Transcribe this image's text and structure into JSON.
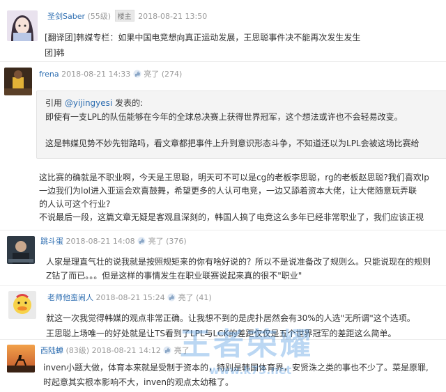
{
  "posts": [
    {
      "user": "圣剑Saber",
      "level": "(55级)",
      "badge": "楼主",
      "time": "2018-08-21 13:50",
      "lines": [
        "[翻译团]韩媒专栏：如果中国电竞想向真正运动发展，王思聪事件决不能再次发生发生",
        "团]韩"
      ]
    },
    {
      "user": "frena",
      "time": "2018-08-21 14:33",
      "like": "亮了",
      "like_count": "(274)",
      "quote": {
        "head_prefix": "引用",
        "head_user": "@yijingyesi",
        "head_suffix": "发表的:",
        "line1": "即使有一支LPL的队伍能够在今年的全球总决赛上获得世界冠军，这个想法或许也不会轻易改变。",
        "line2": "这是韩媒见势不妙先钳路吗，看文章都把事件上升到意识形态斗争，不知道还以为LPL会被这场比赛给"
      },
      "lines": [
        "这比赛的确就是不职业啊，今天是王思聪，明天可不可以是cg的老板李思聪，rg的老板赵思聪?我们喜欢lp",
        "一边我们为lol进入亚运会欢喜鼓舞，希望更多的人认可电竞，一边又舔着资本大佬，让大佬随意玩弄联",
        "的人认可这个行业?",
        "不说最后一段，这篇文章无疑是客观且深刻的，韩国人搞了电竞这么多年已经非常职业了，我们应该正视"
      ]
    },
    {
      "user": "跳斗蛋",
      "time": "2018-08-21 14:08",
      "like": "亮了",
      "like_count": "(376)",
      "lines": [
        "人家是理直气壮的说我就是按照规矩来的你有啥好说的？所以不是说准备改了规则么。只能说现在的规则",
        "Z钻了而已。。。但是这样的事情发生在职业联赛说起来真的很不\"职业\""
      ]
    },
    {
      "user": "老师他蛮闹人",
      "time": "2018-08-21 15:24",
      "like": "亮了",
      "like_count": "(41)",
      "lines": [
        "就这一次我觉得韩媒的观点非常正确。让我想不到的是虎扑居然会有30%的人选\"无所谓\"这个选项。",
        "王思聪上场唯一的好处就是让TS看到了LPL与LCK的差距仅仅是五个世界冠军的差距这么简单。"
      ]
    },
    {
      "user": "西陆蝉",
      "level": "(83级)",
      "time": "2018-08-21 14:12",
      "like": "亮了",
      "lines": [
        "inven小题大做，体育本来就是受制于资本的，特别是韩国体育界，安贤洙之类的事也不少了。菜是原罪,",
        "时起意其实根本影响不大，inven的观点太幼稚了。"
      ]
    }
  ],
  "watermark": {
    "main": "王者荣耀",
    "sub": "www.k73.net"
  },
  "colors": {
    "username": "#2b6cb0",
    "meta": "#999999",
    "quote_bg": "#f4f4f4",
    "watermark": "#3c8cdc"
  }
}
